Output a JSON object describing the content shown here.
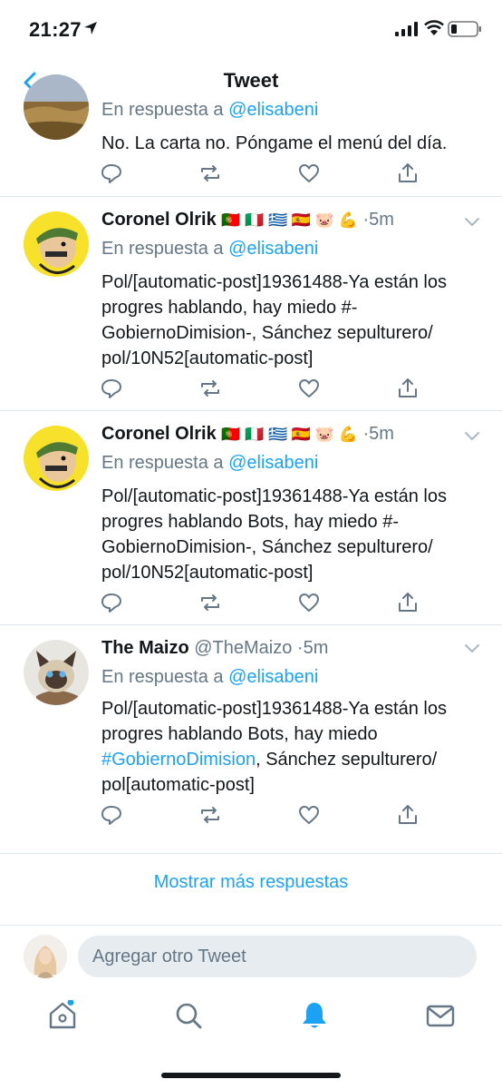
{
  "status_bar": {
    "time": "21:27"
  },
  "nav": {
    "title": "Tweet"
  },
  "tweets": [
    {
      "reply_prefix": "En respuesta a",
      "mention": "@elisabeni",
      "body": "No. La carta no. Póngame el menú del día."
    },
    {
      "name": "Coronel Olrik",
      "emojis": "🇵🇹 🇮🇹 🇬🇷 🇪🇸 🐷 💪",
      "dot": "·",
      "time": "5m",
      "reply_prefix": "En respuesta a",
      "mention": "@elisabeni",
      "body": "Pol/[automatic-post]19361488-Ya están los progres hablando, hay miedo #-GobiernoDimision-, Sánchez sepulturero/ pol/10N52[automatic-post]"
    },
    {
      "name": "Coronel Olrik",
      "emojis": "🇵🇹 🇮🇹 🇬🇷 🇪🇸 🐷 💪",
      "dot": "·",
      "time": "5m",
      "reply_prefix": "En respuesta a",
      "mention": "@elisabeni",
      "body": "Pol/[automatic-post]19361488-Ya están los progres hablando Bots, hay miedo #-GobiernoDimision-, Sánchez sepulturero/ pol/10N52[automatic-post]"
    },
    {
      "name": "The Maizo",
      "handle": "@TheMaizo",
      "dot": "·",
      "time": "5m",
      "reply_prefix": "En respuesta a",
      "mention": "@elisabeni",
      "body_start": "Pol/[automatic-post]19361488-Ya están los progres hablando Bots, hay miedo ",
      "hashtag": "#GobiernoDimision",
      "body_end": ", Sánchez sepulturero/ pol[automatic-post]"
    }
  ],
  "show_more": "Mostrar más respuestas",
  "compose": {
    "placeholder": "Agregar otro Tweet"
  },
  "colors": {
    "accent": "#1da1f2",
    "secondary_text": "#657786",
    "divider": "#e1e8ed"
  },
  "icons": [
    "back-icon",
    "reply-icon",
    "retweet-icon",
    "like-icon",
    "share-icon",
    "chevron-down-icon",
    "home-icon",
    "search-icon",
    "notifications-icon",
    "messages-icon"
  ]
}
